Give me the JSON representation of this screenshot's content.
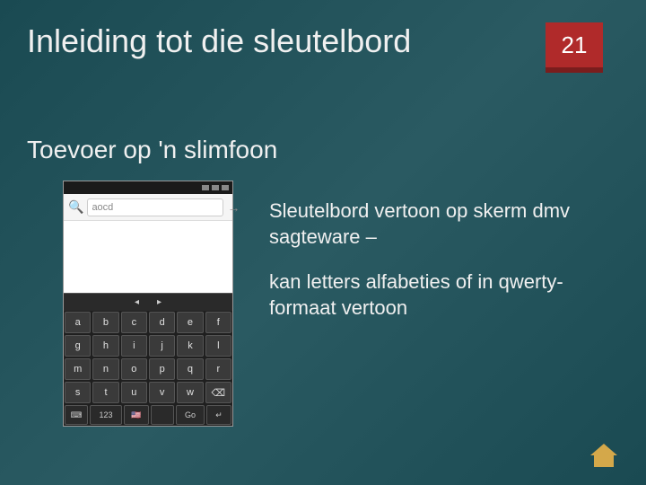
{
  "header": {
    "title": "Inleiding tot die sleutelbord",
    "page_number": "21"
  },
  "subtitle": "Toevoer op 'n slimfoon",
  "phone": {
    "search_value": "aocd",
    "suggestion_left": "◂",
    "suggestion_right": "▸",
    "row1": [
      "a",
      "b",
      "c",
      "d",
      "e",
      "f"
    ],
    "row2": [
      "g",
      "h",
      "i",
      "j",
      "k",
      "l"
    ],
    "row3": [
      "m",
      "n",
      "o",
      "p",
      "q",
      "r"
    ],
    "row4": [
      "s",
      "t",
      "u",
      "v",
      "w",
      "⌫"
    ],
    "bottom": {
      "sym": "⌨",
      "num": "123",
      "flag": "🇺🇸",
      "space": "",
      "go": "Go",
      "enter": "↵"
    }
  },
  "body": {
    "p1": "Sleutelbord vertoon op skerm dmv sagteware –",
    "p2": "kan letters alfabeties of in qwerty-formaat vertoon"
  }
}
